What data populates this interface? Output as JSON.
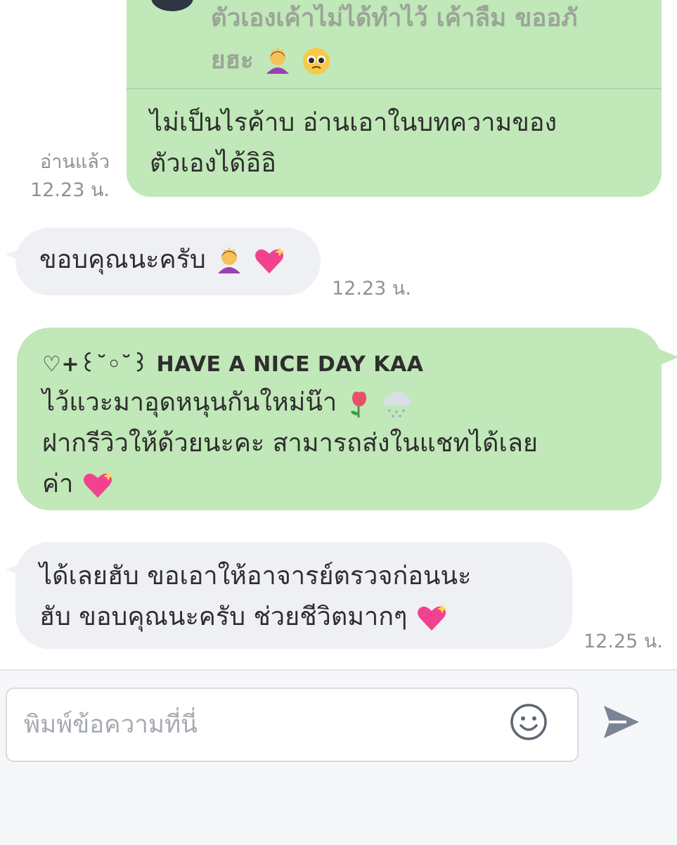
{
  "quoted_message": {
    "text_line1": "ตัวเองเค้าไม่ได้ทำไว้ เค้าลืม ขออภั",
    "text_line2": "ยฮะ"
  },
  "messages": [
    {
      "side": "right",
      "line1": "ไม่เป็นไรค้าบ อ่านเอาในบทความของ",
      "line2": "ตัวเองได้อิอิ",
      "read_label": "อ่านแล้ว",
      "time": "12.23 น."
    },
    {
      "side": "left",
      "text": "ขอบคุณนะครับ",
      "time": "12.23 น."
    },
    {
      "side": "right",
      "heading_prefix": "♡+꒰˘◦˘꒱",
      "heading": "HAVE A NICE DAY KAA",
      "line1": "ไว้แวะมาอุดหนุนกันใหม่น๊า",
      "line2": "ฝากรีวิวให้ด้วยนะคะ สามารถส่งในแชทได้เลย",
      "line3": "ค่า"
    },
    {
      "side": "left",
      "line1": "ได้เลยฮับ ขอเอาให้อาจารย์ตรวจก่อนนะ",
      "line2": "ฮับ ขอบคุณนะครับ ช่วยชีวิตมากๆ",
      "time": "12.25 น."
    }
  ],
  "composer": {
    "placeholder": "พิมพ์ข้อความที่นี่",
    "emoji_icon": "smiley-icon",
    "send_icon": "send-arrow-icon"
  },
  "colors": {
    "outgoing_bubble": "#c1e8b8",
    "incoming_bubble": "#eef0f4",
    "meta_text": "#8d929a",
    "send_icon": "#7b8494"
  }
}
